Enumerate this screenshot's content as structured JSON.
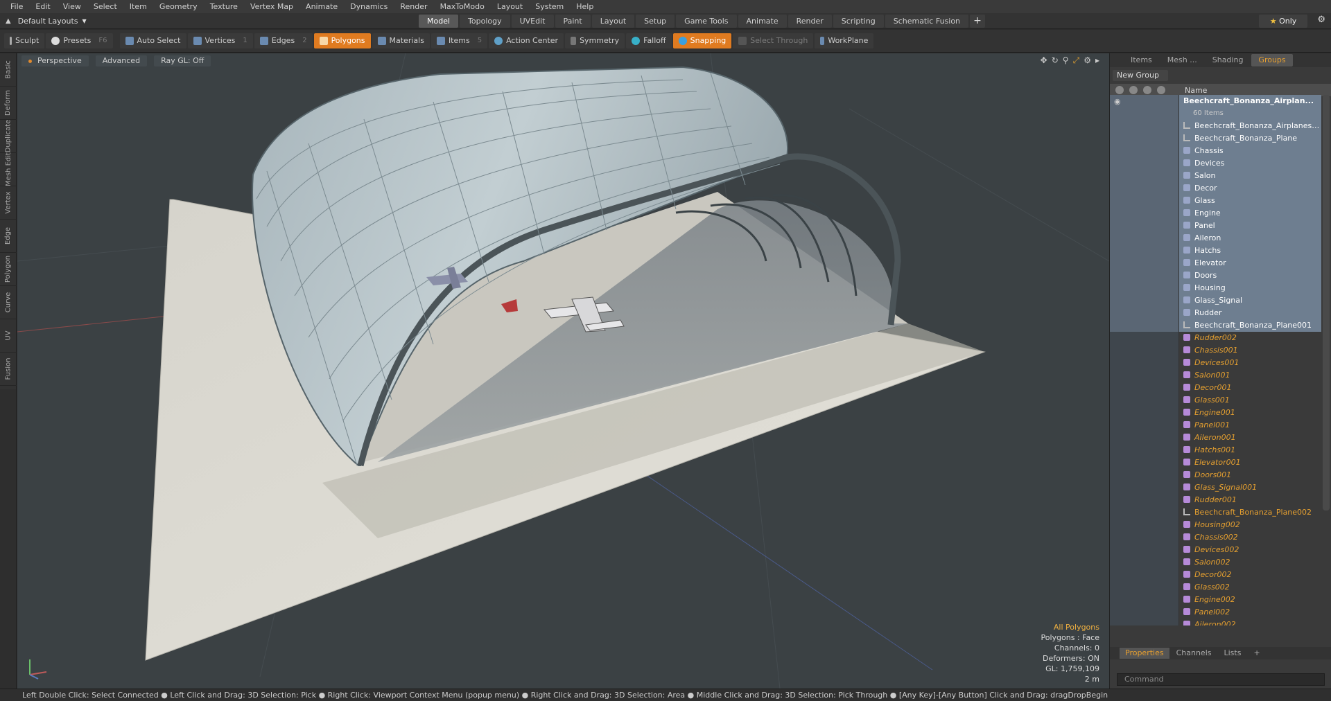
{
  "menu": [
    "File",
    "Edit",
    "View",
    "Select",
    "Item",
    "Geometry",
    "Texture",
    "Vertex Map",
    "Animate",
    "Dynamics",
    "Render",
    "MaxToModo",
    "Layout",
    "System",
    "Help"
  ],
  "layout_dropdown": "Default Layouts",
  "mode_tabs": [
    {
      "label": "Model",
      "active": true
    },
    {
      "label": "Topology"
    },
    {
      "label": "UVEdit"
    },
    {
      "label": "Paint"
    },
    {
      "label": "Layout"
    },
    {
      "label": "Setup"
    },
    {
      "label": "Game Tools"
    },
    {
      "label": "Animate"
    },
    {
      "label": "Render"
    },
    {
      "label": "Scripting"
    },
    {
      "label": "Schematic Fusion"
    }
  ],
  "only_label": "Only",
  "toolbar": {
    "sculpt": "Sculpt",
    "presets": "Presets",
    "presets_hotkey": "F6",
    "auto_select": "Auto Select",
    "vertices": "Vertices",
    "vertices_hotkey": "1",
    "edges": "Edges",
    "edges_hotkey": "2",
    "polygons": "Polygons",
    "materials": "Materials",
    "items": "Items",
    "items_hotkey": "5",
    "action_center": "Action Center",
    "symmetry": "Symmetry",
    "falloff": "Falloff",
    "snapping": "Snapping",
    "select_through": "Select Through",
    "workplane": "WorkPlane"
  },
  "left_tabs": [
    "Basic",
    "Deform",
    "Duplicate",
    "Mesh Edit",
    "Vertex",
    "Edge",
    "Polygon",
    "Curve",
    "UV",
    "Fusion"
  ],
  "viewport": {
    "view": "Perspective",
    "shading": "Advanced",
    "raygl": "Ray GL: Off",
    "info": {
      "all": "All Polygons",
      "polygons": "Polygons : Face",
      "channels": "Channels: 0",
      "deformers": "Deformers: ON",
      "gl": "GL: 1,759,109",
      "scale": "2 m"
    }
  },
  "right_panel": {
    "tabs": [
      {
        "label": "Items"
      },
      {
        "label": "Mesh ..."
      },
      {
        "label": "Shading"
      },
      {
        "label": "Groups",
        "active": true
      }
    ],
    "new_group": "New Group",
    "col_name": "Name",
    "group_name": "Beechcraft_Bonanza_Airplan...",
    "group_count": "60 Items",
    "items": [
      {
        "label": "Beechcraft_Bonanza_Airplanes ...",
        "kind": "loc",
        "style": "sel"
      },
      {
        "label": "Beechcraft_Bonanza_Plane",
        "kind": "loc",
        "style": "sel"
      },
      {
        "label": "Chassis",
        "kind": "mesh",
        "style": "sel"
      },
      {
        "label": "Devices",
        "kind": "mesh",
        "style": "sel"
      },
      {
        "label": "Salon",
        "kind": "mesh",
        "style": "sel"
      },
      {
        "label": "Decor",
        "kind": "mesh",
        "style": "sel"
      },
      {
        "label": "Glass",
        "kind": "mesh",
        "style": "sel"
      },
      {
        "label": "Engine",
        "kind": "mesh",
        "style": "sel"
      },
      {
        "label": "Panel",
        "kind": "mesh",
        "style": "sel"
      },
      {
        "label": "Aileron",
        "kind": "mesh",
        "style": "sel"
      },
      {
        "label": "Hatchs",
        "kind": "mesh",
        "style": "sel"
      },
      {
        "label": "Elevator",
        "kind": "mesh",
        "style": "sel"
      },
      {
        "label": "Doors",
        "kind": "mesh",
        "style": "sel"
      },
      {
        "label": "Housing",
        "kind": "mesh",
        "style": "sel"
      },
      {
        "label": "Glass_Signal",
        "kind": "mesh",
        "style": "sel"
      },
      {
        "label": "Rudder",
        "kind": "mesh",
        "style": "sel"
      },
      {
        "label": "Beechcraft_Bonanza_Plane001",
        "kind": "loc",
        "style": "sel"
      },
      {
        "label": "Rudder002",
        "kind": "mesh",
        "style": "italic"
      },
      {
        "label": "Chassis001",
        "kind": "mesh",
        "style": "italic"
      },
      {
        "label": "Devices001",
        "kind": "mesh",
        "style": "italic"
      },
      {
        "label": "Salon001",
        "kind": "mesh",
        "style": "italic"
      },
      {
        "label": "Decor001",
        "kind": "mesh",
        "style": "italic"
      },
      {
        "label": "Glass001",
        "kind": "mesh",
        "style": "italic"
      },
      {
        "label": "Engine001",
        "kind": "mesh",
        "style": "italic"
      },
      {
        "label": "Panel001",
        "kind": "mesh",
        "style": "italic"
      },
      {
        "label": "Aileron001",
        "kind": "mesh",
        "style": "italic"
      },
      {
        "label": "Hatchs001",
        "kind": "mesh",
        "style": "italic"
      },
      {
        "label": "Elevator001",
        "kind": "mesh",
        "style": "italic"
      },
      {
        "label": "Doors001",
        "kind": "mesh",
        "style": "italic"
      },
      {
        "label": "Glass_Signal001",
        "kind": "mesh",
        "style": "italic"
      },
      {
        "label": "Rudder001",
        "kind": "mesh",
        "style": "italic"
      },
      {
        "label": "Beechcraft_Bonanza_Plane002",
        "kind": "loc",
        "style": "plainorange"
      },
      {
        "label": "Housing002",
        "kind": "mesh",
        "style": "italic"
      },
      {
        "label": "Chassis002",
        "kind": "mesh",
        "style": "italic"
      },
      {
        "label": "Devices002",
        "kind": "mesh",
        "style": "italic"
      },
      {
        "label": "Salon002",
        "kind": "mesh",
        "style": "italic"
      },
      {
        "label": "Decor002",
        "kind": "mesh",
        "style": "italic"
      },
      {
        "label": "Glass002",
        "kind": "mesh",
        "style": "italic"
      },
      {
        "label": "Engine002",
        "kind": "mesh",
        "style": "italic"
      },
      {
        "label": "Panel002",
        "kind": "mesh",
        "style": "italic"
      },
      {
        "label": "Aileron002",
        "kind": "mesh",
        "style": "italic"
      }
    ],
    "bottom_tabs": [
      {
        "label": "Properties",
        "active": true
      },
      {
        "label": "Channels"
      },
      {
        "label": "Lists"
      },
      {
        "label": "+"
      }
    ],
    "command_placeholder": "Command"
  },
  "statusbar": "Left Double Click: Select Connected ● Left Click and Drag: 3D Selection: Pick ● Right Click: Viewport Context Menu (popup menu) ● Right Click and Drag: 3D Selection: Area ● Middle Click and Drag: 3D Selection: Pick Through ● [Any Key]-[Any Button] Click and Drag: dragDropBegin"
}
